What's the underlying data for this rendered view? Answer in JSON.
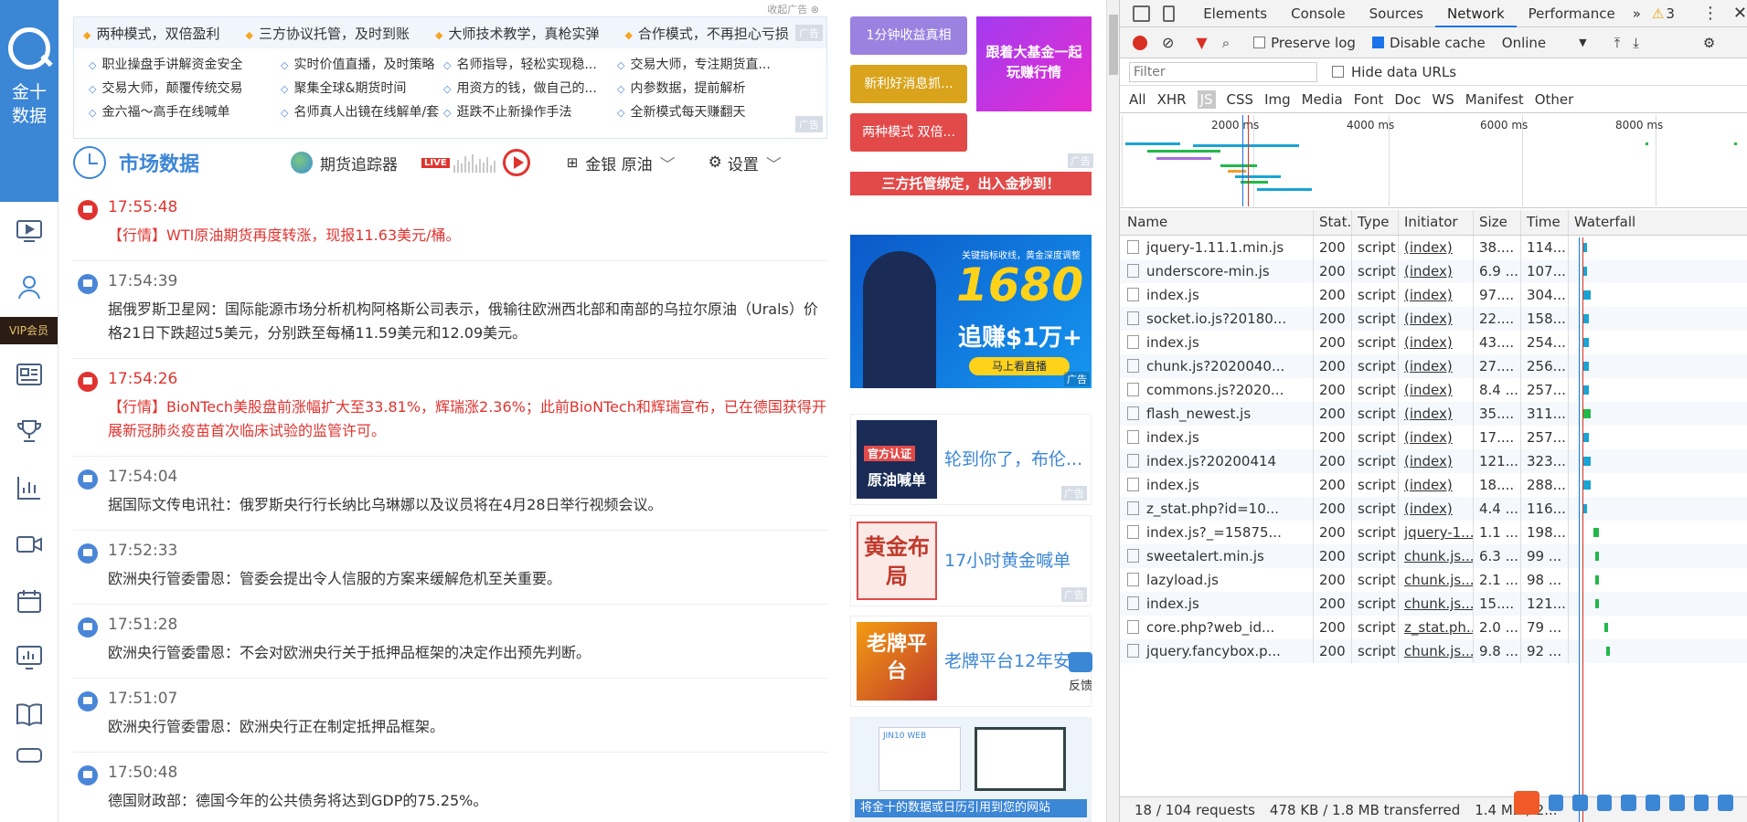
{
  "sidebar": {
    "logo_line1": "金十",
    "logo_line2": "数据",
    "vip_label": "VIP会员",
    "icons": [
      "video-icon",
      "user-icon",
      "news-icon",
      "trophy-icon",
      "chart-icon",
      "camera-icon",
      "calendar-icon",
      "monitor-icon",
      "book-icon",
      "vr-icon"
    ]
  },
  "top_ad": {
    "close_label": "收起广告",
    "tag": "广告",
    "headline_items": [
      "两种模式，双倍盈利",
      "三方协议托管，及时到账",
      "大师技术教学，真枪实弹",
      "合作模式，不再担心亏损"
    ],
    "links": [
      "职业操盘手讲解资金安全",
      "实时价值直播，及时策略",
      "名师指导，轻松实现稳...",
      "交易大师，专注期货直...",
      "交易大师，颠覆传统交易",
      "聚集全球&期货时间",
      "用资方的钱，做自己的...",
      "内参数据，提前解析",
      "金六福～高手在线喊单",
      "名师真人出镜在线解单/套",
      "逛跌不止新操作手法",
      "全新模式每天赚翻天"
    ]
  },
  "market_header": {
    "title": "市场数据",
    "tracker_label": "期货追踪器",
    "live_badge": "LIVE",
    "filter_label": "金银 原油",
    "settings_label": "设置"
  },
  "feed": [
    {
      "time": "17:55:48",
      "text": "【行情】WTI原油期货再度转涨，现报11.63美元/桶。",
      "important": true
    },
    {
      "time": "17:54:39",
      "text": "据俄罗斯卫星网：国际能源市场分析机构阿格斯公司表示，俄输往欧洲西北部和南部的乌拉尔原油（Urals）价格21日下跌超过5美元，分别跌至每桶11.59美元和12.09美元。",
      "important": false
    },
    {
      "time": "17:54:26",
      "text": "【行情】BioNTech美股盘前涨幅扩大至33.81%，辉瑞涨2.36%；此前BioNTech和辉瑞宣布，已在德国获得开展新冠肺炎疫苗首次临床试验的监管许可。",
      "important": true
    },
    {
      "time": "17:54:04",
      "text": "据国际文传电讯社：俄罗斯央行行长纳比乌琳娜以及议员将在4月28日举行视频会议。",
      "important": false
    },
    {
      "time": "17:52:33",
      "text": "欧洲央行管委雷恩：管委会提出令人信服的方案来缓解危机至关重要。",
      "important": false
    },
    {
      "time": "17:51:28",
      "text": "欧洲央行管委雷恩：不会对欧洲央行关于抵押品框架的决定作出预先判断。",
      "important": false
    },
    {
      "time": "17:51:07",
      "text": "欧洲央行管委雷恩：欧洲央行正在制定抵押品框架。",
      "important": false
    },
    {
      "time": "17:50:48",
      "text": "德国财政部：德国今年的公共债务将达到GDP的75.25%。",
      "important": false
    }
  ],
  "right_ads": {
    "tag": "广告",
    "btn1": "1分钟收益真相",
    "btn2": "新利好消息抓...",
    "btn3": "两种模式 双倍...",
    "banner_side": "跟着大基金一起玩赚行情",
    "strip": "三方托管绑定，出入金秒到！",
    "big_banner_num": "1680",
    "big_banner_text": "追赚$1万+",
    "big_banner_cta": "马上看直播",
    "big_banner_top": "关键指标收线，黄金深度调整",
    "cards": [
      {
        "thumb": "原油喊单",
        "badge": "官方认证",
        "label": "轮到你了，布伦..."
      },
      {
        "thumb": "黄金布局",
        "label": "17小时黄金喊单"
      },
      {
        "thumb": "老牌平台",
        "label": "老牌平台12年安"
      }
    ],
    "bottom_caption": "将金十的数据或日历引用到您的网站",
    "bottom_brand": "JIN10 WEB"
  },
  "feedback_label": "反馈",
  "devtools": {
    "tabs": [
      "Elements",
      "Console",
      "Sources",
      "Network",
      "Performance"
    ],
    "active_tab": "Network",
    "more": "»",
    "warnings": "3",
    "preserve_log": "Preserve log",
    "disable_cache": "Disable cache",
    "throttle": "Online",
    "filter_placeholder": "Filter",
    "hide_data_urls": "Hide data URLs",
    "types": [
      "All",
      "XHR",
      "JS",
      "CSS",
      "Img",
      "Media",
      "Font",
      "Doc",
      "WS",
      "Manifest",
      "Other"
    ],
    "active_type": "JS",
    "overview_ticks": [
      "2000 ms",
      "4000 ms",
      "6000 ms",
      "8000 ms"
    ],
    "columns": [
      "Name",
      "Stat...",
      "Type",
      "Initiator",
      "Size",
      "Time",
      "Waterfall"
    ],
    "rows": [
      {
        "name": "jquery-1.11.1.min.js",
        "status": "200",
        "type": "script",
        "initiator": "(index)",
        "size": "38....",
        "time": "114...",
        "wf_start": 0.08,
        "wf_len": 0.02,
        "wf_color": "#1aa3d4"
      },
      {
        "name": "underscore-min.js",
        "status": "200",
        "type": "script",
        "initiator": "(index)",
        "size": "6.9 ...",
        "time": "107...",
        "wf_start": 0.08,
        "wf_len": 0.02,
        "wf_color": "#1aa3d4"
      },
      {
        "name": "index.js",
        "status": "200",
        "type": "script",
        "initiator": "(index)",
        "size": "97....",
        "time": "304...",
        "wf_start": 0.08,
        "wf_len": 0.04,
        "wf_color": "#1aa3d4"
      },
      {
        "name": "socket.io.js?20180...",
        "status": "200",
        "type": "script",
        "initiator": "(index)",
        "size": "22....",
        "time": "158...",
        "wf_start": 0.08,
        "wf_len": 0.03,
        "wf_color": "#1aa3d4"
      },
      {
        "name": "index.js",
        "status": "200",
        "type": "script",
        "initiator": "(index)",
        "size": "43....",
        "time": "254...",
        "wf_start": 0.08,
        "wf_len": 0.03,
        "wf_color": "#1aa3d4"
      },
      {
        "name": "chunk.js?2020040...",
        "status": "200",
        "type": "script",
        "initiator": "(index)",
        "size": "27....",
        "time": "256...",
        "wf_start": 0.08,
        "wf_len": 0.03,
        "wf_color": "#1aa3d4"
      },
      {
        "name": "commons.js?2020...",
        "status": "200",
        "type": "script",
        "initiator": "(index)",
        "size": "8.4 ...",
        "time": "257...",
        "wf_start": 0.08,
        "wf_len": 0.03,
        "wf_color": "#1aa3d4"
      },
      {
        "name": "flash_newest.js",
        "status": "200",
        "type": "script",
        "initiator": "(index)",
        "size": "35....",
        "time": "311...",
        "wf_start": 0.08,
        "wf_len": 0.04,
        "wf_color": "#22b84a"
      },
      {
        "name": "index.js",
        "status": "200",
        "type": "script",
        "initiator": "(index)",
        "size": "17....",
        "time": "257...",
        "wf_start": 0.08,
        "wf_len": 0.03,
        "wf_color": "#1aa3d4"
      },
      {
        "name": "index.js?20200414",
        "status": "200",
        "type": "script",
        "initiator": "(index)",
        "size": "121...",
        "time": "323...",
        "wf_start": 0.08,
        "wf_len": 0.04,
        "wf_color": "#1aa3d4"
      },
      {
        "name": "index.js",
        "status": "200",
        "type": "script",
        "initiator": "(index)",
        "size": "18....",
        "time": "288...",
        "wf_start": 0.08,
        "wf_len": 0.04,
        "wf_color": "#1aa3d4"
      },
      {
        "name": "z_stat.php?id=10...",
        "status": "200",
        "type": "script",
        "initiator": "(index)",
        "size": "4.4 ...",
        "time": "116...",
        "wf_start": 0.08,
        "wf_len": 0.02,
        "wf_color": "#1aa3d4"
      },
      {
        "name": "index.js?_=15875...",
        "status": "200",
        "type": "script",
        "initiator": "jquery-1....",
        "size": "1.1 ...",
        "time": "198...",
        "wf_start": 0.14,
        "wf_len": 0.03,
        "wf_color": "#22b84a"
      },
      {
        "name": "sweetalert.min.js",
        "status": "200",
        "type": "script",
        "initiator": "chunk.js....",
        "size": "6.3 ...",
        "time": "99 ...",
        "wf_start": 0.15,
        "wf_len": 0.02,
        "wf_color": "#22b84a"
      },
      {
        "name": "lazyload.js",
        "status": "200",
        "type": "script",
        "initiator": "chunk.js....",
        "size": "2.1 ...",
        "time": "98 ...",
        "wf_start": 0.15,
        "wf_len": 0.02,
        "wf_color": "#22b84a"
      },
      {
        "name": "index.js",
        "status": "200",
        "type": "script",
        "initiator": "chunk.js....",
        "size": "15....",
        "time": "121...",
        "wf_start": 0.15,
        "wf_len": 0.02,
        "wf_color": "#22b84a"
      },
      {
        "name": "core.php?web_id...",
        "status": "200",
        "type": "script",
        "initiator": "z_stat.ph...",
        "size": "2.0 ...",
        "time": "79 ...",
        "wf_start": 0.2,
        "wf_len": 0.02,
        "wf_color": "#22b84a"
      },
      {
        "name": "jquery.fancybox.p...",
        "status": "200",
        "type": "script",
        "initiator": "chunk.js....",
        "size": "9.8 ...",
        "time": "92 ...",
        "wf_start": 0.21,
        "wf_len": 0.02,
        "wf_color": "#22b84a"
      }
    ],
    "summary_requests": "18 / 104 requests",
    "summary_transferred": "478 KB / 1.8 MB transferred",
    "summary_resources": "1.4 MB / 2..."
  }
}
